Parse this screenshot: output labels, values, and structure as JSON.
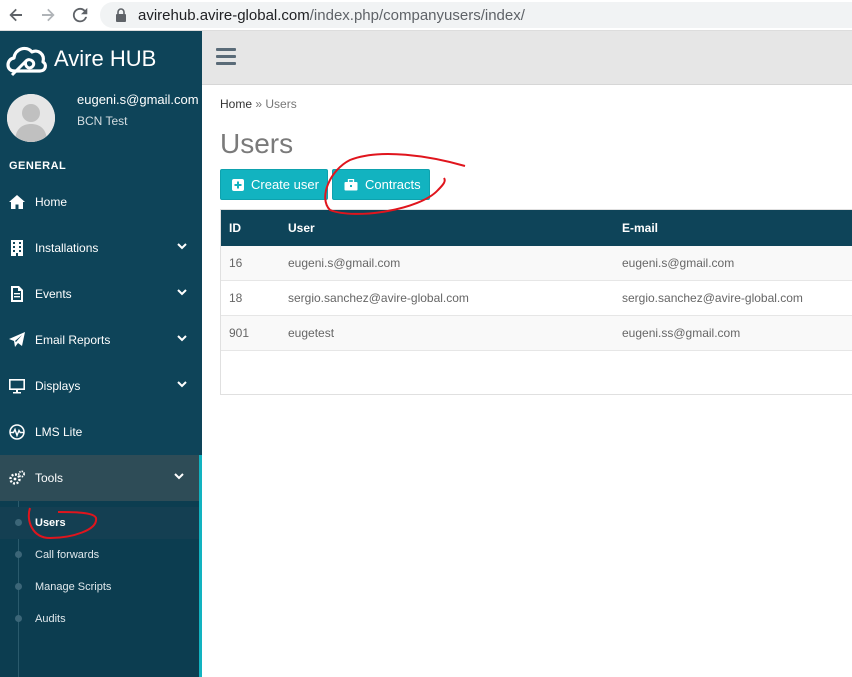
{
  "browser": {
    "url_host": "avirehub.avire-global.com",
    "url_path": "/index.php/companyusers/index/"
  },
  "sidebar": {
    "brand": "Avire HUB",
    "profile": {
      "email": "eugeni.s@gmail.com",
      "org": "BCN Test"
    },
    "section": "GENERAL",
    "items": [
      {
        "label": "Home",
        "icon": "home-icon"
      },
      {
        "label": "Installations",
        "icon": "building-icon"
      },
      {
        "label": "Events",
        "icon": "document-icon"
      },
      {
        "label": "Email Reports",
        "icon": "paper-plane-icon"
      },
      {
        "label": "Displays",
        "icon": "monitor-icon"
      },
      {
        "label": "LMS Lite",
        "icon": "pulse-icon"
      },
      {
        "label": "Tools",
        "icon": "gears-icon"
      }
    ],
    "tools_submenu": [
      "Users",
      "Call forwards",
      "Manage Scripts",
      "Audits"
    ]
  },
  "main": {
    "breadcrumb": {
      "home": "Home",
      "sep": "»",
      "current": "Users"
    },
    "title": "Users",
    "buttons": {
      "create": "Create user",
      "contracts": "Contracts"
    },
    "table": {
      "columns": [
        "ID",
        "User",
        "E-mail"
      ],
      "rows": [
        [
          "16",
          "eugeni.s@gmail.com",
          "eugeni.s@gmail.com"
        ],
        [
          "18",
          "sergio.sanchez@avire-global.com",
          "sergio.sanchez@avire-global.com"
        ],
        [
          "901",
          "eugetest",
          "eugeni.ss@gmail.com"
        ]
      ]
    }
  },
  "colors": {
    "sidebar_bg": "#0e4459",
    "accent": "#12b3c0",
    "annotation_red": "#e0151d"
  }
}
